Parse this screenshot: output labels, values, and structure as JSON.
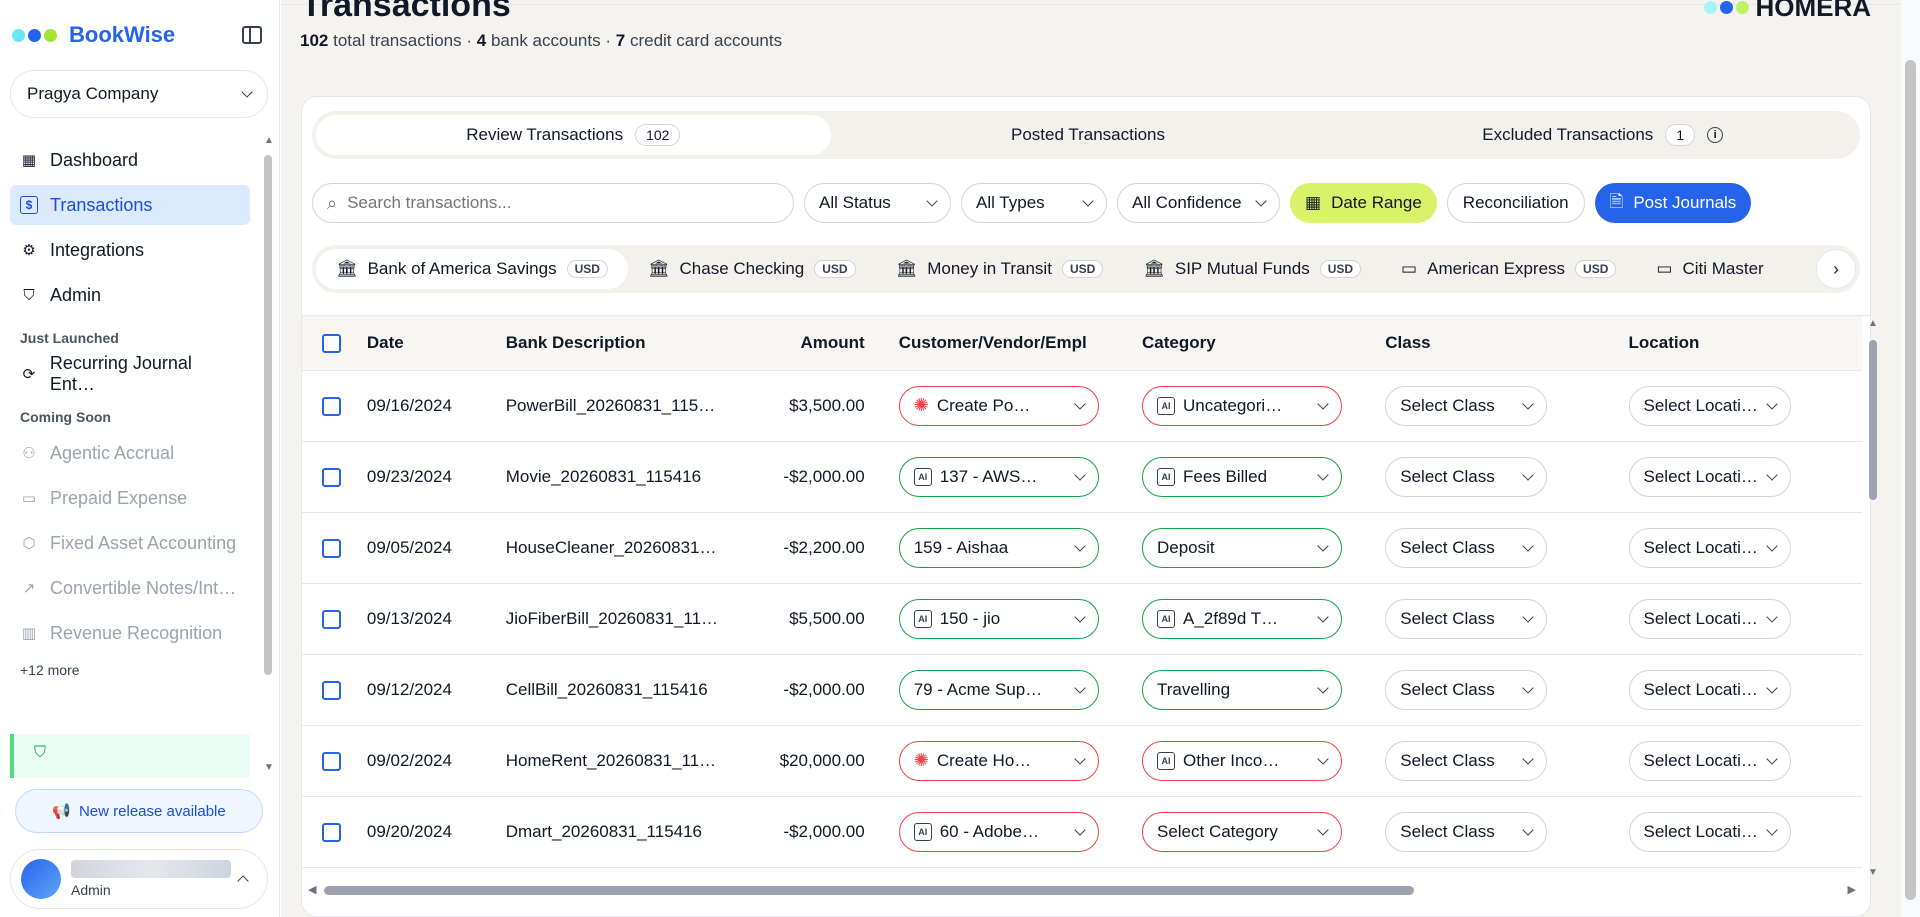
{
  "app": {
    "brand": "BookWise",
    "brand_dot_colors": [
      "#67e8f9",
      "#2563eb",
      "#a3e635"
    ],
    "company": "Pragya Company"
  },
  "sidebar": {
    "nav": [
      {
        "label": "Dashboard",
        "icon": "grid-icon"
      },
      {
        "label": "Transactions",
        "icon": "dollar-icon",
        "active": true
      },
      {
        "label": "Integrations",
        "icon": "gear-icon"
      },
      {
        "label": "Admin",
        "icon": "shield-icon"
      }
    ],
    "just_launched_heading": "Just Launched",
    "just_launched": [
      {
        "label": "Recurring Journal Ent…",
        "icon": "refresh-icon"
      }
    ],
    "coming_soon_heading": "Coming Soon",
    "coming_soon": [
      {
        "label": "Agentic Accrual",
        "icon": "robot-icon"
      },
      {
        "label": "Prepaid Expense",
        "icon": "wallet-icon"
      },
      {
        "label": "Fixed Asset Accounting",
        "icon": "cube-icon"
      },
      {
        "label": "Convertible Notes/Int…",
        "icon": "trend-icon"
      },
      {
        "label": "Revenue Recognition",
        "icon": "bar-chart-icon"
      }
    ],
    "more_link": "+12 more",
    "release_banner": "New release available",
    "user_role": "Admin"
  },
  "header": {
    "title": "Transactions",
    "summary": {
      "total_transactions": "102",
      "total_label": "total transactions",
      "bank_accounts": "4",
      "bank_label": "bank accounts",
      "credit_accounts": "7",
      "credit_label": "credit card accounts",
      "separator": "·"
    },
    "corner_logo_text": "HOMERA"
  },
  "tabs": [
    {
      "label": "Review Transactions",
      "count": "102",
      "active": true
    },
    {
      "label": "Posted Transactions"
    },
    {
      "label": "Excluded Transactions",
      "count": "1"
    }
  ],
  "filters": {
    "search_placeholder": "Search transactions...",
    "status": "All Status",
    "types": "All Types",
    "confidence": "All Confidence",
    "date_range": "Date Range",
    "reconciliation": "Reconciliation",
    "post_journals": "Post Journals"
  },
  "accounts": [
    {
      "name": "Bank of America Savings",
      "currency": "USD",
      "icon": "bank-icon",
      "active": true
    },
    {
      "name": "Chase Checking",
      "currency": "USD",
      "icon": "bank-icon"
    },
    {
      "name": "Money in Transit",
      "currency": "USD",
      "icon": "bank-icon"
    },
    {
      "name": "SIP Mutual Funds",
      "currency": "USD",
      "icon": "bank-icon"
    },
    {
      "name": "American Express",
      "currency": "USD",
      "icon": "card-icon"
    },
    {
      "name": "Citi Master",
      "currency": "",
      "icon": "card-icon"
    }
  ],
  "table": {
    "columns": [
      "Date",
      "Bank Description",
      "Amount",
      "Customer/Vendor/Empl",
      "Category",
      "Class",
      "Location"
    ],
    "rows": [
      {
        "date": "09/16/2024",
        "description": "PowerBill_20260831_115…",
        "amount": "$3,500.00",
        "customer": {
          "text": "Create Po…",
          "status": "red",
          "icon": "sparkle-icon"
        },
        "category": {
          "text": "Uncategori…",
          "status": "red",
          "icon": "ai-icon"
        },
        "class": "Select Class",
        "location": "Select Location"
      },
      {
        "date": "09/23/2024",
        "description": "Movie_20260831_115416",
        "amount": "-$2,000.00",
        "customer": {
          "text": "137 - AWS…",
          "status": "green",
          "icon": "ai-icon"
        },
        "category": {
          "text": "Fees Billed",
          "status": "green",
          "icon": "ai-icon"
        },
        "class": "Select Class",
        "location": "Select Location"
      },
      {
        "date": "09/05/2024",
        "description": "HouseCleaner_20260831…",
        "amount": "-$2,200.00",
        "customer": {
          "text": "159 - Aishaa",
          "status": "green",
          "icon": ""
        },
        "category": {
          "text": "Deposit",
          "status": "green",
          "icon": ""
        },
        "class": "Select Class",
        "location": "Select Location"
      },
      {
        "date": "09/13/2024",
        "description": "JioFiberBill_20260831_11…",
        "amount": "$5,500.00",
        "customer": {
          "text": "150 - jio",
          "status": "green",
          "icon": "ai-icon"
        },
        "category": {
          "text": "A_2f89d T…",
          "status": "green",
          "icon": "ai-icon"
        },
        "class": "Select Class",
        "location": "Select Location"
      },
      {
        "date": "09/12/2024",
        "description": "CellBill_20260831_115416",
        "amount": "-$2,000.00",
        "customer": {
          "text": "79 - Acme Sup…",
          "status": "green",
          "icon": ""
        },
        "category": {
          "text": "Travelling",
          "status": "green",
          "icon": ""
        },
        "class": "Select Class",
        "location": "Select Location"
      },
      {
        "date": "09/02/2024",
        "description": "HomeRent_20260831_11…",
        "amount": "$20,000.00",
        "customer": {
          "text": "Create Ho…",
          "status": "red",
          "icon": "sparkle-icon"
        },
        "category": {
          "text": "Other Inco…",
          "status": "red",
          "icon": "ai-icon"
        },
        "class": "Select Class",
        "location": "Select Location"
      },
      {
        "date": "09/20/2024",
        "description": "Dmart_20260831_115416",
        "amount": "-$2,000.00",
        "customer": {
          "text": "60 - Adobe…",
          "status": "red",
          "icon": "ai-icon"
        },
        "category": {
          "text": "Select Category",
          "status": "red",
          "icon": ""
        },
        "class": "Select Class",
        "location": "Select Location"
      }
    ]
  },
  "colors": {
    "accent": "#2563eb",
    "date_range_bg": "#d9f26a",
    "status_red": "#ef4444",
    "status_green": "#16a34a"
  }
}
